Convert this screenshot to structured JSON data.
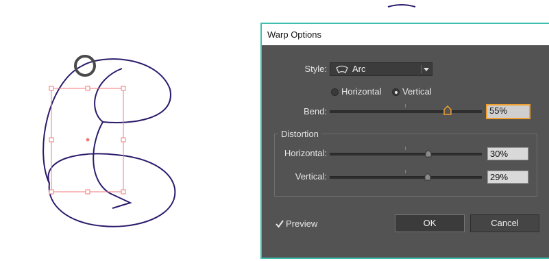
{
  "dialog": {
    "title": "Warp Options",
    "style_label": "Style:",
    "style_value": "Arc",
    "style_icon": "arc-warp-icon",
    "orientation": {
      "horizontal_label": "Horizontal",
      "vertical_label": "Vertical",
      "selected": "Vertical"
    },
    "bend": {
      "label": "Bend:",
      "value": "55%",
      "level": 0.55
    },
    "distortion": {
      "title": "Distortion",
      "horizontal": {
        "label": "Horizontal:",
        "value": "30%",
        "level": 0.3
      },
      "vertical": {
        "label": "Vertical:",
        "value": "29%",
        "level": 0.29
      }
    },
    "preview_label": "Preview",
    "preview_checked": true,
    "ok_label": "OK",
    "cancel_label": "Cancel"
  },
  "colors": {
    "path_stroke": "#2b1a6b",
    "selection": "#f07a7a",
    "dialog_bg": "#535353",
    "dialog_border": "#3fbfad",
    "field_focus": "#f0a030"
  }
}
